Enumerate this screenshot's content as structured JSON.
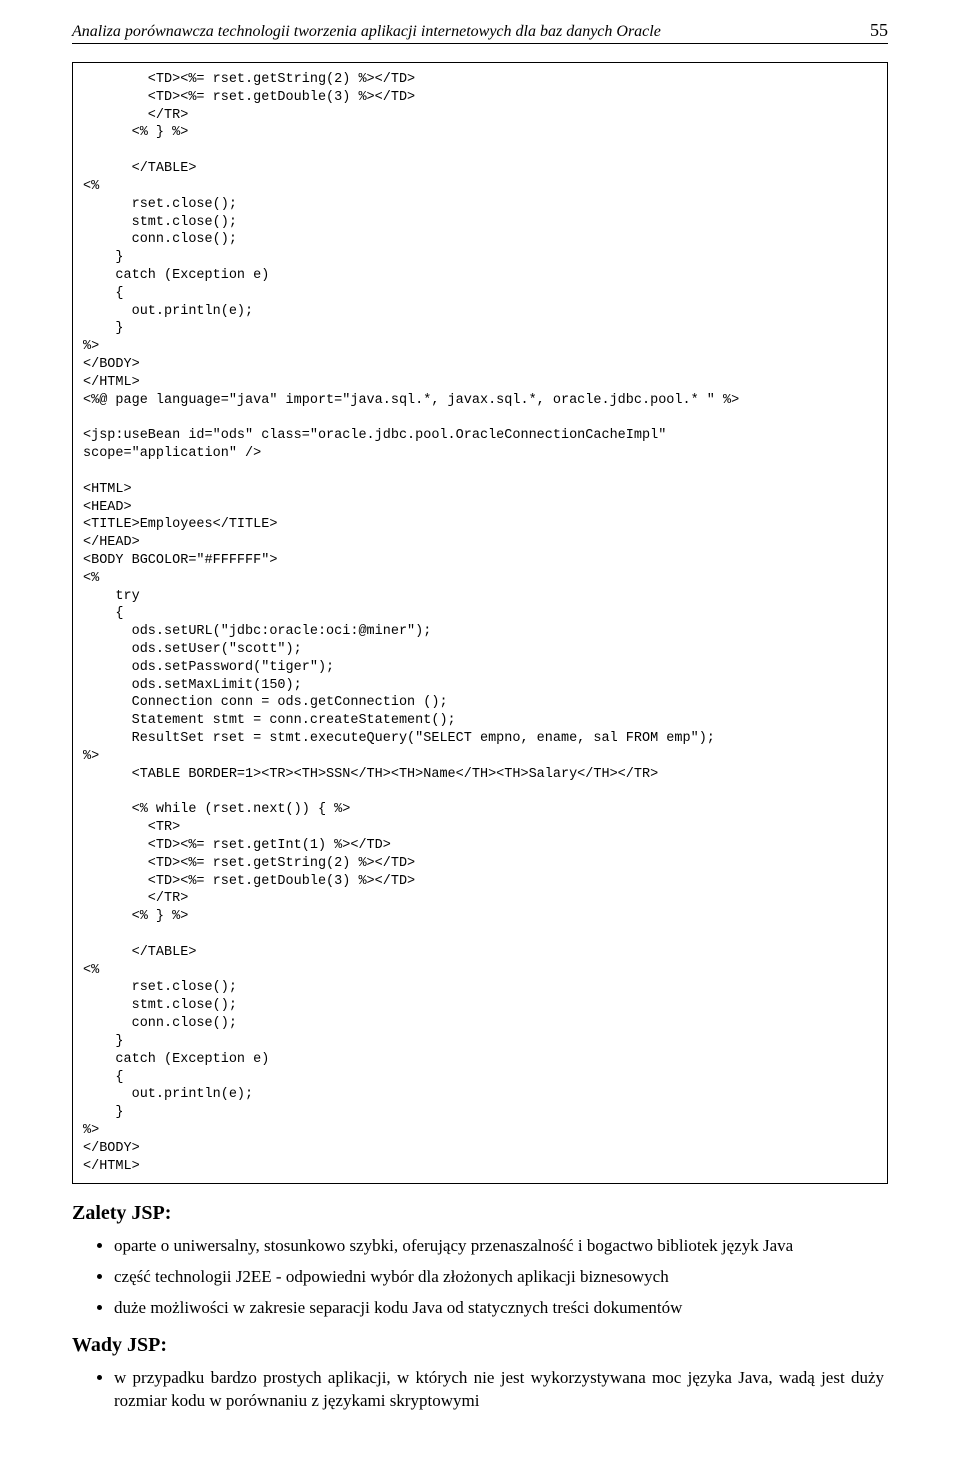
{
  "header": {
    "title": "Analiza porównawcza technologii tworzenia aplikacji internetowych dla baz danych Oracle",
    "page_number": "55"
  },
  "code": {
    "lines": [
      "        <TD><%= rset.getString(2) %></TD>",
      "        <TD><%= rset.getDouble(3) %></TD>",
      "        </TR>",
      "      <% } %>",
      "",
      "      </TABLE>",
      "<%",
      "      rset.close();",
      "      stmt.close();",
      "      conn.close();",
      "    }",
      "    catch (Exception e)",
      "    {",
      "      out.println(e);",
      "    }",
      "%>",
      "</BODY>",
      "</HTML>",
      "<%@ page language=\"java\" import=\"java.sql.*, javax.sql.*, oracle.jdbc.pool.* \" %>",
      "",
      "<jsp:useBean id=\"ods\" class=\"oracle.jdbc.pool.OracleConnectionCacheImpl\"",
      "scope=\"application\" />",
      "",
      "<HTML>",
      "<HEAD>",
      "<TITLE>Employees</TITLE>",
      "</HEAD>",
      "<BODY BGCOLOR=\"#FFFFFF\">",
      "<%",
      "    try",
      "    {",
      "      ods.setURL(\"jdbc:oracle:oci:@miner\");",
      "      ods.setUser(\"scott\");",
      "      ods.setPassword(\"tiger\");",
      "      ods.setMaxLimit(150);",
      "      Connection conn = ods.getConnection ();",
      "      Statement stmt = conn.createStatement();",
      "      ResultSet rset = stmt.executeQuery(\"SELECT empno, ename, sal FROM emp\");",
      "%>",
      "      <TABLE BORDER=1><TR><TH>SSN</TH><TH>Name</TH><TH>Salary</TH></TR>",
      "",
      "      <% while (rset.next()) { %>",
      "        <TR>",
      "        <TD><%= rset.getInt(1) %></TD>",
      "        <TD><%= rset.getString(2) %></TD>",
      "        <TD><%= rset.getDouble(3) %></TD>",
      "        </TR>",
      "      <% } %>",
      "",
      "      </TABLE>",
      "<%",
      "      rset.close();",
      "      stmt.close();",
      "      conn.close();",
      "    }",
      "    catch (Exception e)",
      "    {",
      "      out.println(e);",
      "    }",
      "%>",
      "</BODY>",
      "</HTML>"
    ]
  },
  "sections": {
    "zalety_heading": "Zalety JSP:",
    "zalety_items": [
      "oparte o uniwersalny, stosunkowo szybki, oferujący przenaszalność i bogactwo bibliotek język Java",
      "część technologii J2EE - odpowiedni wybór dla złożonych aplikacji biznesowych",
      "duże możliwości w zakresie separacji kodu Java od statycznych treści dokumentów"
    ],
    "wady_heading": "Wady JSP:",
    "wady_items": [
      "w przypadku bardzo prostych aplikacji, w których nie jest wykorzystywana moc języka Java, wadą jest duży rozmiar kodu w porównaniu z językami skryptowymi"
    ]
  }
}
